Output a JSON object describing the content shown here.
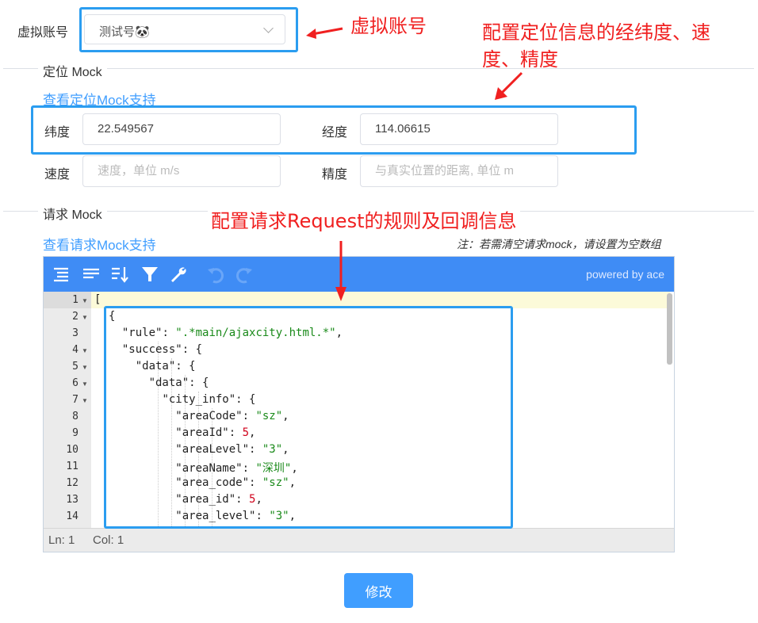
{
  "account": {
    "label": "虚拟账号",
    "value": "测试号🐼"
  },
  "location": {
    "section_title": "定位 Mock",
    "link": "查看定位Mock支持",
    "lat_label": "纬度",
    "lat_value": "22.549567",
    "lng_label": "经度",
    "lng_value": "114.06615",
    "speed_label": "速度",
    "speed_placeholder": "速度，单位 m/s",
    "accuracy_label": "精度",
    "accuracy_placeholder": "与真实位置的距离, 单位 m"
  },
  "request": {
    "section_title": "请求 Mock",
    "link": "查看请求Mock支持",
    "note": "注：若需清空请求mock，请设置为空数组"
  },
  "editor": {
    "powered": "powered by ace",
    "status_ln": "Ln: 1",
    "status_col": "Col: 1",
    "line_numbers": [
      "1",
      "2",
      "3",
      "4",
      "5",
      "6",
      "7",
      "8",
      "9",
      "10",
      "11",
      "12",
      "13",
      "14"
    ],
    "lines": [
      "[",
      "{",
      "  \"rule\": \".*main/ajaxcity.html.*\",",
      "  \"success\": {",
      "    \"data\": {",
      "      \"data\": {",
      "        \"city_info\": {",
      "          \"areaCode\": \"sz\",",
      "          \"areaId\": 5,",
      "          \"areaLevel\": \"3\",",
      "          \"areaName\": \"深圳\",",
      "          \"area_code\": \"sz\",",
      "          \"area_id\": 5,",
      "          \"area_level\": \"3\","
    ]
  },
  "submit_label": "修改",
  "annotations": {
    "account": "虚拟账号",
    "location_line1": "配置定位信息的经纬度、速",
    "location_line2": "度、精度",
    "request": "配置请求Request的规则及回调信息"
  },
  "colors": {
    "accent": "#409eff",
    "toolbar": "#3f8cf5",
    "highlight": "#2b9df0",
    "annotation": "#f02020"
  }
}
